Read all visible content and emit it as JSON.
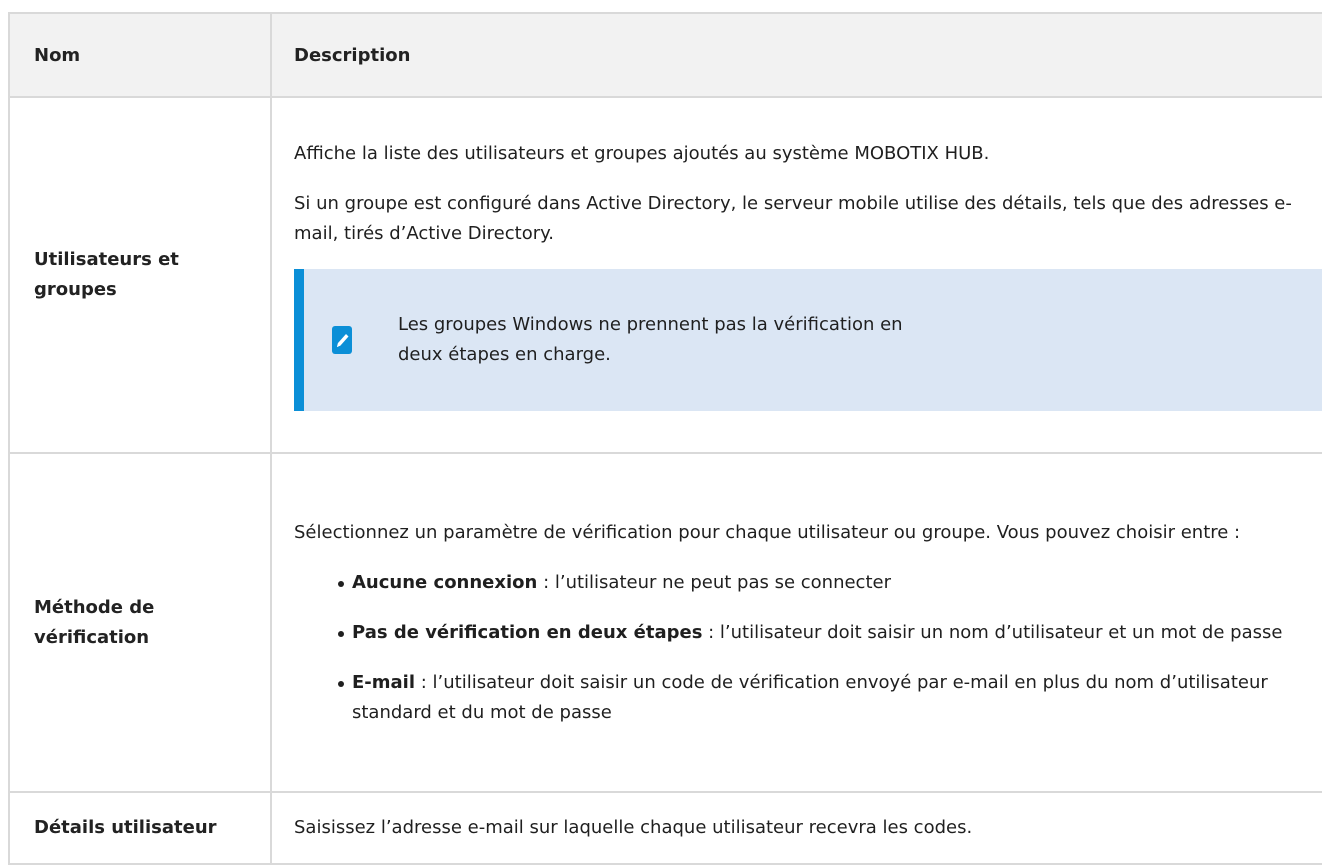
{
  "table": {
    "headers": {
      "name": "Nom",
      "description": "Description"
    },
    "rows": [
      {
        "name": "Utilisateurs et groupes",
        "paragraphs": [
          "Affiche la liste des utilisateurs et groupes ajoutés au système MOBOTIX HUB.",
          "Si un groupe est configuré dans Active Directory, le serveur mobile utilise des détails, tels que des adresses e-mail, tirés d’Active Directory."
        ],
        "note": {
          "icon": "pencil-icon",
          "text": "Les groupes Windows ne prennent pas la vérification en deux étapes en charge."
        }
      },
      {
        "name": "Méthode de vérification",
        "intro": "Sélectionnez un paramètre de vérification pour chaque utilisateur ou groupe. Vous pouvez choisir entre :",
        "options": [
          {
            "term": "Aucune connexion",
            "text": " : l’utilisateur ne peut pas se connecter"
          },
          {
            "term": "Pas de vérification en deux étapes",
            "text": " : l’utilisateur doit saisir un nom d’utilisateur et un mot de passe"
          },
          {
            "term": "E-mail",
            "text": " : l’utilisateur doit saisir un code de vérification envoyé par e-mail en plus du nom d’utilisateur standard et du mot de passe"
          }
        ]
      },
      {
        "name": "Détails utilisateur",
        "text": "Saisissez l’adresse e-mail sur laquelle chaque utilisateur recevra les codes."
      }
    ]
  },
  "colors": {
    "note_background": "#dbe6f4",
    "note_accent": "#0b8fd7",
    "header_background": "#f2f2f2",
    "border": "#d9d9d9"
  }
}
